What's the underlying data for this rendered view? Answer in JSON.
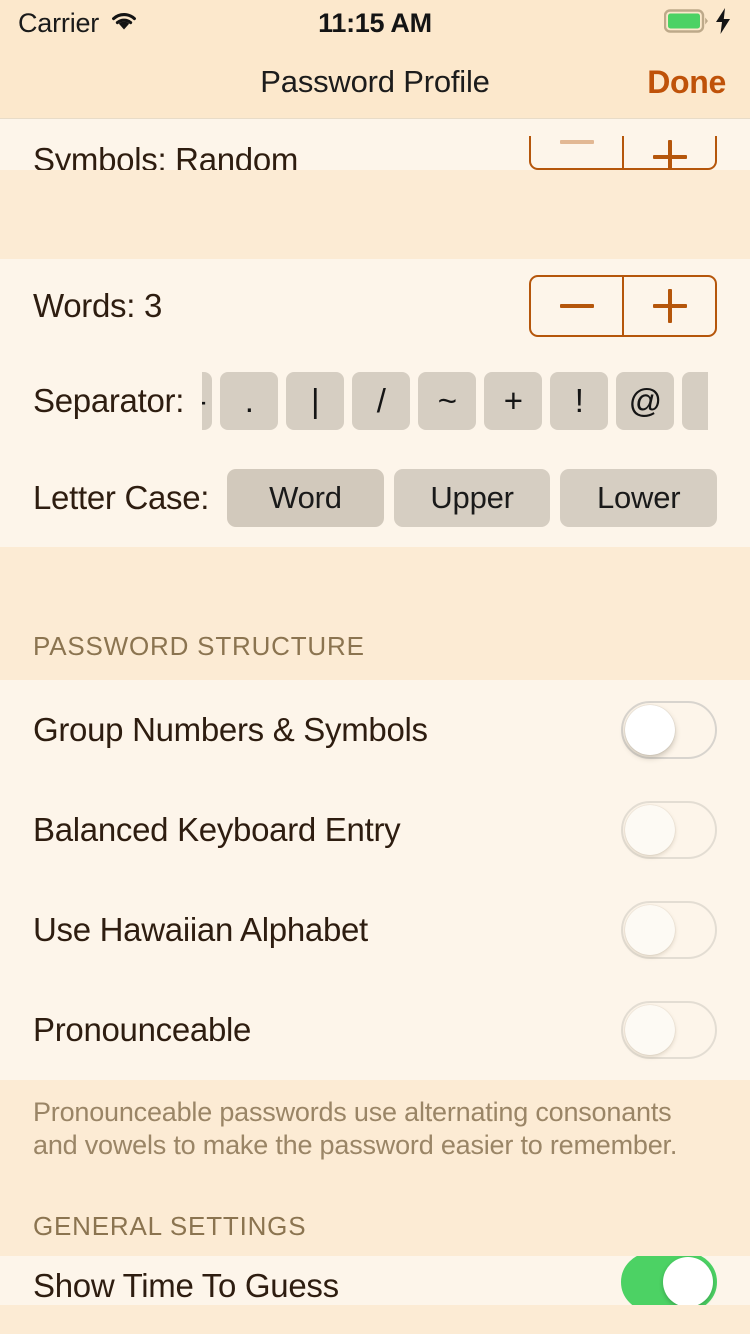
{
  "status_bar": {
    "carrier": "Carrier",
    "wifi_icon": "wifi-icon",
    "time": "11:15 AM",
    "battery_icon": "battery-full-icon",
    "charging_icon": "lightning-bolt-icon",
    "battery_color": "#4CD264"
  },
  "nav": {
    "title": "Password Profile",
    "done_label": "Done",
    "done_color": "#BF5209"
  },
  "symbols_row": {
    "label": "Symbols: Random",
    "minus_label": "minus-icon",
    "plus_label": "plus-icon",
    "minus_disabled": true
  },
  "words_row": {
    "label": "Words: 3",
    "minus_label": "minus-icon",
    "plus_label": "plus-icon"
  },
  "separator_row": {
    "label": "Separator:",
    "options": [
      "-",
      ".",
      "|",
      "/",
      "~",
      "+",
      "!",
      "@"
    ]
  },
  "letter_case_row": {
    "label": "Letter Case:",
    "options": [
      "Word",
      "Upper",
      "Lower"
    ],
    "selected": "Word"
  },
  "password_structure": {
    "header": "PASSWORD STRUCTURE",
    "rows": [
      {
        "label": "Group Numbers & Symbols",
        "on": false
      },
      {
        "label": "Balanced Keyboard Entry",
        "on": false
      },
      {
        "label": "Use Hawaiian Alphabet",
        "on": false
      },
      {
        "label": "Pronounceable",
        "on": false
      }
    ],
    "footer": "Pronounceable passwords use alternating consonants and vowels to make the password easier to remember."
  },
  "general_settings": {
    "header": "GENERAL SETTINGS",
    "rows": [
      {
        "label": "Show Time To Guess",
        "on": true
      }
    ]
  }
}
